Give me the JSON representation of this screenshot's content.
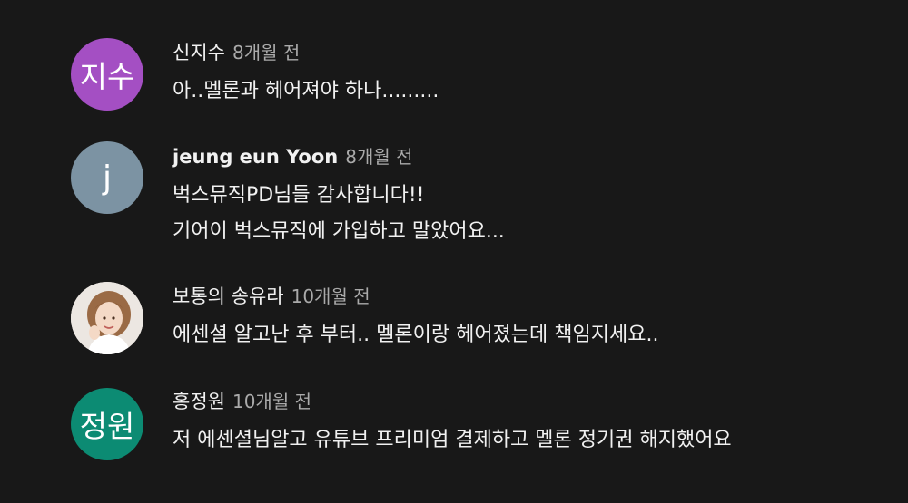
{
  "comments": [
    {
      "avatar_text": "지수",
      "avatar_color": "#a44fc3",
      "author": "신지수",
      "time": "8개월 전",
      "lines": [
        "아..멜론과 헤어져야 하나........."
      ]
    },
    {
      "avatar_text": "j",
      "avatar_color": "#7c93a3",
      "author": "jeung eun Yoon",
      "time": "8개월 전",
      "lines": [
        "벅스뮤직PD님들 감사합니다!!",
        "기어이 벅스뮤직에 가입하고 말았어요..."
      ]
    },
    {
      "avatar_icon": "profile-photo",
      "author": "보통의 송유라",
      "time": "10개월 전",
      "lines": [
        "에센셜 알고난 후 부터.. 멜론이랑 헤어졌는데 책임지세요.."
      ]
    },
    {
      "avatar_text": "정원",
      "avatar_color": "#0c8b73",
      "author": "홍정원",
      "time": "10개월 전",
      "lines": [
        "저 에센셜님알고 유튜브 프리미엄 결제하고 멜론 정기권 해지했어요"
      ]
    }
  ]
}
